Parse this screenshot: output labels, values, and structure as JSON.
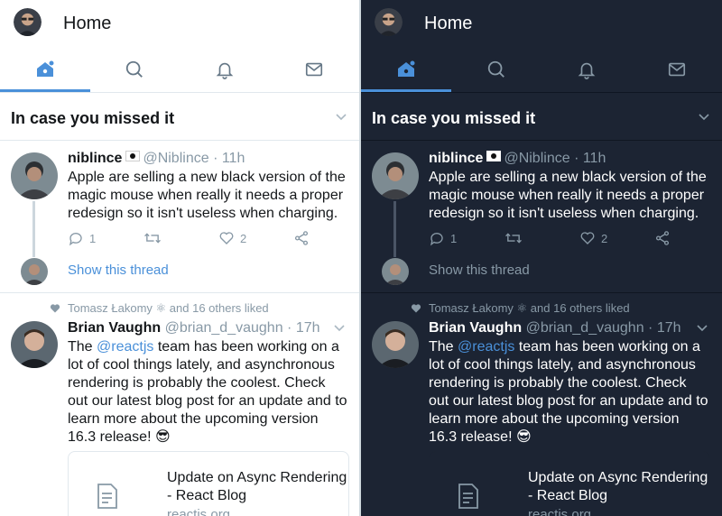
{
  "header": {
    "title": "Home"
  },
  "tabs": [
    {
      "icon": "home-icon",
      "active": true
    },
    {
      "icon": "search-icon",
      "active": false
    },
    {
      "icon": "notifications-bell-icon",
      "active": false
    },
    {
      "icon": "messages-envelope-icon",
      "active": false
    }
  ],
  "section": {
    "title": "In case you missed it"
  },
  "tweet1": {
    "name": "niblince",
    "handle": "@Niblince",
    "time": "· 11h",
    "text": "Apple are selling a new black version of the magic mouse when really it needs a proper redesign so it isn't useless when charging.",
    "reply_count": "1",
    "like_count": "2"
  },
  "thread": {
    "label": "Show this thread"
  },
  "tweet2": {
    "liked_by": "Tomasz Łakomy ⚛ and 16 others liked",
    "name": "Brian Vaughn",
    "handle": "@brian_d_vaughn",
    "time": "· 17h",
    "text_before": "The ",
    "mention": "@reactjs",
    "text_after": " team has been working on a lot of cool things lately, and asynchronous rendering is probably the coolest. Check out our latest blog post for an update and to learn more about the upcoming version 16.3 release! 😎"
  },
  "card": {
    "title": "Update on Async Rendering - React Blog",
    "domain": "reactjs.org"
  },
  "colors": {
    "light_bg": "#ffffff",
    "dark_bg": "#1c2433",
    "accent": "#4a90d9",
    "muted": "#8899a6"
  }
}
